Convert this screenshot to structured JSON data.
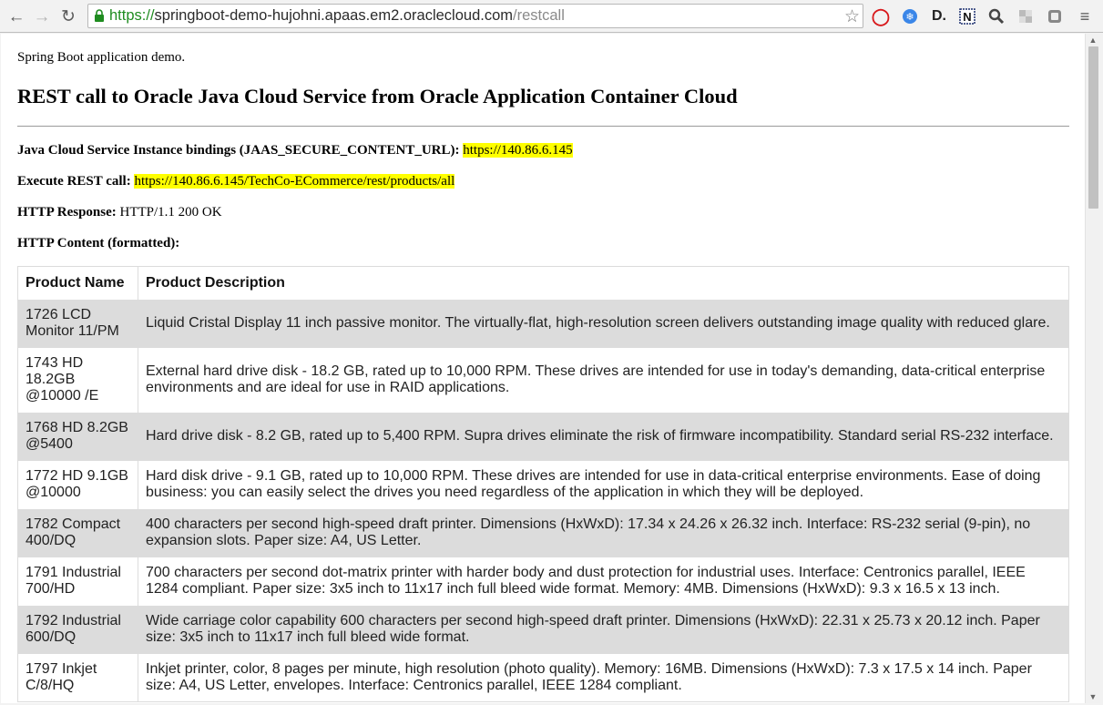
{
  "browser": {
    "url_scheme": "https://",
    "url_host": "springboot-demo-hujohni.apaas.em2.oraclecloud.com",
    "url_path": "/restcall"
  },
  "page": {
    "intro": "Spring Boot application demo.",
    "heading": "REST call to Oracle Java Cloud Service from Oracle Application Container Cloud",
    "bindings_label": "Java Cloud Service Instance bindings (JAAS_SECURE_CONTENT_URL):",
    "bindings_value": "https://140.86.6.145",
    "execute_label": "Execute REST call:",
    "execute_value": "https://140.86.6.145/TechCo-ECommerce/rest/products/all",
    "response_label": "HTTP Response:",
    "response_value": "HTTP/1.1 200 OK",
    "content_label": "HTTP Content (formatted):"
  },
  "table": {
    "headers": [
      "Product Name",
      "Product Description"
    ],
    "rows": [
      {
        "name": "1726 LCD Monitor 11/PM",
        "description": "Liquid Cristal Display 11 inch passive monitor. The virtually-flat, high-resolution screen delivers outstanding image quality with reduced glare."
      },
      {
        "name": "1743 HD 18.2GB @10000 /E",
        "description": "External hard drive disk - 18.2 GB, rated up to 10,000 RPM. These drives are intended for use in today's demanding, data-critical enterprise environments and are ideal for use in RAID applications."
      },
      {
        "name": "1768 HD 8.2GB @5400",
        "description": "Hard drive disk - 8.2 GB, rated up to 5,400 RPM. Supra drives eliminate the risk of firmware incompatibility. Standard serial RS-232 interface."
      },
      {
        "name": "1772 HD 9.1GB @10000",
        "description": "Hard disk drive - 9.1 GB, rated up to 10,000 RPM. These drives are intended for use in data-critical enterprise environments. Ease of doing business: you can easily select the drives you need regardless of the application in which they will be deployed."
      },
      {
        "name": "1782 Compact 400/DQ",
        "description": "400 characters per second high-speed draft printer. Dimensions (HxWxD): 17.34 x 24.26 x 26.32 inch. Interface: RS-232 serial (9-pin), no expansion slots. Paper size: A4, US Letter."
      },
      {
        "name": "1791 Industrial 700/HD",
        "description": "700 characters per second dot-matrix printer with harder body and dust protection for industrial uses. Interface: Centronics parallel, IEEE 1284 compliant. Paper size: 3x5 inch to 11x17 inch full bleed wide format. Memory: 4MB. Dimensions (HxWxD): 9.3 x 16.5 x 13 inch."
      },
      {
        "name": "1792 Industrial 600/DQ",
        "description": "Wide carriage color capability 600 characters per second high-speed draft printer. Dimensions (HxWxD): 22.31 x 25.73 x 20.12 inch. Paper size: 3x5 inch to 11x17 inch full bleed wide format."
      },
      {
        "name": "1797 Inkjet C/8/HQ",
        "description": "Inkjet printer, color, 8 pages per minute, high resolution (photo quality). Memory: 16MB. Dimensions (HxWxD): 7.3 x 17.5 x 14 inch. Paper size: A4, US Letter, envelopes. Interface: Centronics parallel, IEEE 1284 compliant."
      }
    ]
  }
}
